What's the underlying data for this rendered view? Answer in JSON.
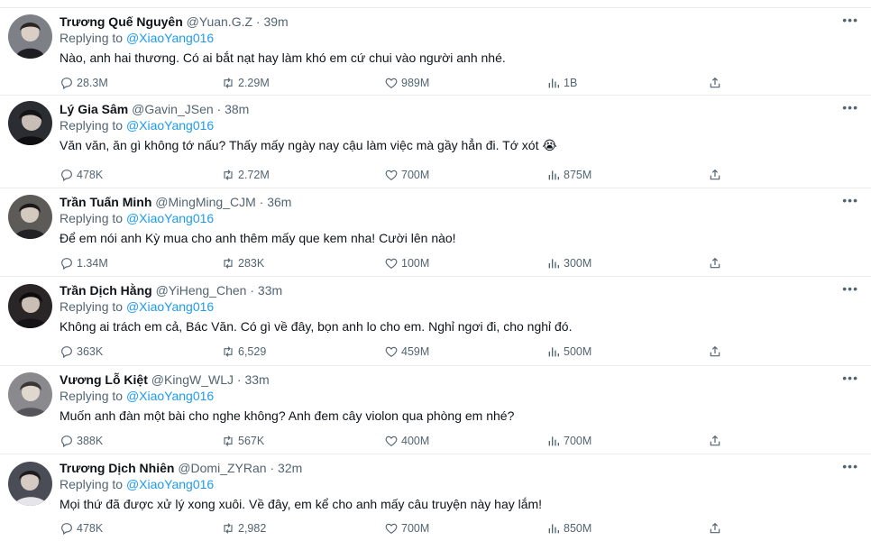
{
  "reply_prefix": "Replying to",
  "tweets": [
    {
      "name": "Trương Quế Nguyên",
      "handle": "@Yuan.G.Z",
      "time": "39m",
      "mention": "@XiaoYang016",
      "text": "Nào, anh hai thương. Có ai bắt nạt hay làm khó em cứ chui vào người anh nhé.",
      "replies": "28.3M",
      "retweets": "2.29M",
      "likes": "989M",
      "views": "1B",
      "avatar_color": "#7e8088"
    },
    {
      "name": "Lý Gia Sâm",
      "handle": "@Gavin_JSen",
      "time": "38m",
      "mention": "@XiaoYang016",
      "text": "Văn văn, ăn gì không tớ nấu? Thấy mấy ngày nay cậu làm việc mà gầy hẳn đi. Tớ xót 😭",
      "replies": "478K",
      "retweets": "2.72M",
      "likes": "700M",
      "views": "875M",
      "avatar_color": "#2b2d33"
    },
    {
      "name": "Trần Tuấn Minh",
      "handle": "@MingMing_CJM",
      "time": "36m",
      "mention": "@XiaoYang016",
      "text": "Để em nói anh Kỳ mua cho anh thêm mấy que kem nha! Cười lên nào!",
      "replies": "1.34M",
      "retweets": "283K",
      "likes": "100M",
      "views": "300M",
      "avatar_color": "#5d5b58"
    },
    {
      "name": "Trần Dịch Hằng",
      "handle": "@YiHeng_Chen",
      "time": "33m",
      "mention": "@XiaoYang016",
      "text": "Không ai trách em cả, Bác Văn. Có gì về đây, bọn anh lo cho em. Nghỉ ngơi đi, cho nghỉ đó.",
      "replies": "363K",
      "retweets": "6,529",
      "likes": "459M",
      "views": "500M",
      "avatar_color": "#2a2526"
    },
    {
      "name": "Vương Lỗ Kiệt",
      "handle": "@KingW_WLJ",
      "time": "33m",
      "mention": "@XiaoYang016",
      "text": "Muốn anh đàn một bài cho nghe không? Anh đem cây violon qua phòng em nhé?",
      "replies": "388K",
      "retweets": "567K",
      "likes": "400M",
      "views": "700M",
      "avatar_color": "#8a8a8e"
    },
    {
      "name": "Trương Dịch Nhiên",
      "handle": "@Domi_ZYRan",
      "time": "32m",
      "mention": "@XiaoYang016",
      "text": "Mọi thứ đã được xử lý xong xuôi. Về đây, em kể cho anh mấy câu truyện này hay lắm!",
      "replies": "478K",
      "retweets": "2,982",
      "likes": "700M",
      "views": "850M",
      "avatar_color": "#4a4d55"
    }
  ]
}
